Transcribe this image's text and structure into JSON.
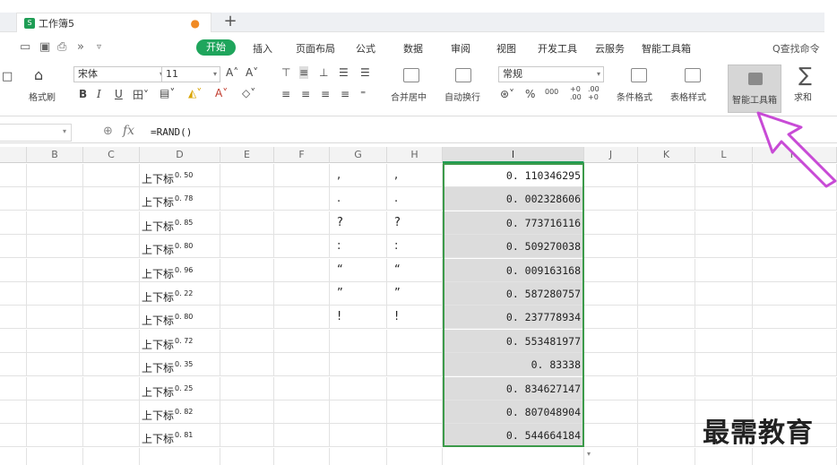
{
  "tab": {
    "title": "工作簿5",
    "new_tab": "+",
    "icon": "spreadsheet-icon"
  },
  "quick_access": [
    "folder-icon",
    "save-icon",
    "print-icon",
    "more-icon",
    "undo-icon"
  ],
  "menu": {
    "active": "开始",
    "items": [
      "插入",
      "页面布局",
      "公式",
      "数据",
      "审阅",
      "视图",
      "开发工具",
      "云服务",
      "智能工具箱"
    ],
    "search": "Q查找命令"
  },
  "ribbon": {
    "format_painter": "格式刷",
    "font_name": "宋体",
    "font_size": "11",
    "merge_center": "合并居中",
    "wrap_text": "自动换行",
    "number_format": "常规",
    "percent": "%",
    "thousand": "000",
    "inc_decimal": "+0\n.00",
    "dec_decimal": ".00\n+0",
    "conditional_format": "条件格式",
    "table_style": "表格样式",
    "smart_toolbox": "智能工具箱",
    "sum": "求和"
  },
  "formula_bar": {
    "fx": "fx",
    "formula": "=RAND()"
  },
  "columns": [
    "B",
    "C",
    "D",
    "E",
    "F",
    "G",
    "H",
    "I",
    "J",
    "K",
    "L",
    "M"
  ],
  "rows": [
    {
      "d_text": "上下标",
      "d_sup": "0. 50",
      "g": ",",
      "h": ",",
      "i": "0. 110346295"
    },
    {
      "d_text": "上下标",
      "d_sup": "0. 78",
      "g": ".",
      "h": ".",
      "i": "0. 002328606"
    },
    {
      "d_text": "上下标",
      "d_sup": "0. 85",
      "g": "?",
      "h": "?",
      "i": "0. 773716116"
    },
    {
      "d_text": "上下标",
      "d_sup": "0. 80",
      "g": ":",
      "h": ":",
      "i": "0. 509270038"
    },
    {
      "d_text": "上下标",
      "d_sup": "0. 96",
      "g": "“",
      "h": "“",
      "i": "0. 009163168"
    },
    {
      "d_text": "上下标",
      "d_sup": "0. 22",
      "g": "”",
      "h": "”",
      "i": "0. 587280757"
    },
    {
      "d_text": "上下标",
      "d_sup": "0. 80",
      "g": "!",
      "h": "!",
      "i": "0. 237778934"
    },
    {
      "d_text": "上下标",
      "d_sup": "0. 72",
      "g": "",
      "h": "",
      "i": "0. 553481977"
    },
    {
      "d_text": "上下标",
      "d_sup": "0. 35",
      "g": "",
      "h": "",
      "i": "0. 83338"
    },
    {
      "d_text": "上下标",
      "d_sup": "0. 25",
      "g": "",
      "h": "",
      "i": "0. 834627147"
    },
    {
      "d_text": "上下标",
      "d_sup": "0. 82",
      "g": "",
      "h": "",
      "i": "0. 807048904"
    },
    {
      "d_text": "上下标",
      "d_sup": "0. 81",
      "g": "",
      "h": "",
      "i": "0. 544664184"
    }
  ],
  "watermark": "最需教育",
  "colors": {
    "accent": "#1fa55c",
    "selection_border": "#3c9a4a",
    "selected_fill": "#dcdcdc",
    "pointer": "#c84bd6"
  }
}
